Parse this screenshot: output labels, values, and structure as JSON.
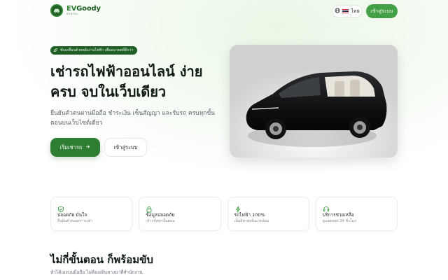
{
  "header": {
    "brand_name_ev": "EV",
    "brand_name_rest": "Goody",
    "brand_sub": "RENTAL",
    "language_label": "ไทย",
    "login_label": "เข้าสู่ระบบ"
  },
  "hero": {
    "badge_text": "ขับเคลื่อนด้วยพลังงานไฟฟ้า เพื่ออนาคตที่ดีกว่า",
    "title_line1": "เช่ารถไฟฟ้าออนไลน์ ง่าย",
    "title_line2": "ครบ จบในเว็บเดียว",
    "desc_line1": "ยืนยันตัวตนผ่านมือถือ ชำระเงิน เซ็นสัญญา และรับรถ ครบทุกขั้น",
    "desc_line2": "ตอนบนเว็บไซต์เดียว",
    "primary_cta": "เริ่มเช่ารถ",
    "secondary_cta": "เข้าสู่ระบบ"
  },
  "features": [
    {
      "icon": "shield-check-icon",
      "title": "ปลอดภัย มั่นใจ",
      "sub": "ยืนยันตัวตนทุกการเช่า"
    },
    {
      "icon": "lock-icon",
      "title": "ข้อมูลปลอดภัย",
      "sub": "เข้ารหัสทุกขั้นตอน"
    },
    {
      "icon": "lightning-icon",
      "title": "รถไฟฟ้า 100%",
      "sub": "เป็นมิตรต่อสิ่งแวดล้อม"
    },
    {
      "icon": "headset-icon",
      "title": "บริการช่วยเหลือ",
      "sub": "ดูแลตลอด 24 ชั่วโมง"
    }
  ],
  "steps": {
    "title": "ไม่กี่ขั้นตอน ก็พร้อมขับ",
    "subtitle": "ทำได้เองบนมือถือ ไม่ต้องเดินทางมาที่สำนักงาน"
  },
  "colors": {
    "brand_green": "#2e7d32",
    "brand_dark": "#1f5f25",
    "button_green": "#43a047"
  }
}
